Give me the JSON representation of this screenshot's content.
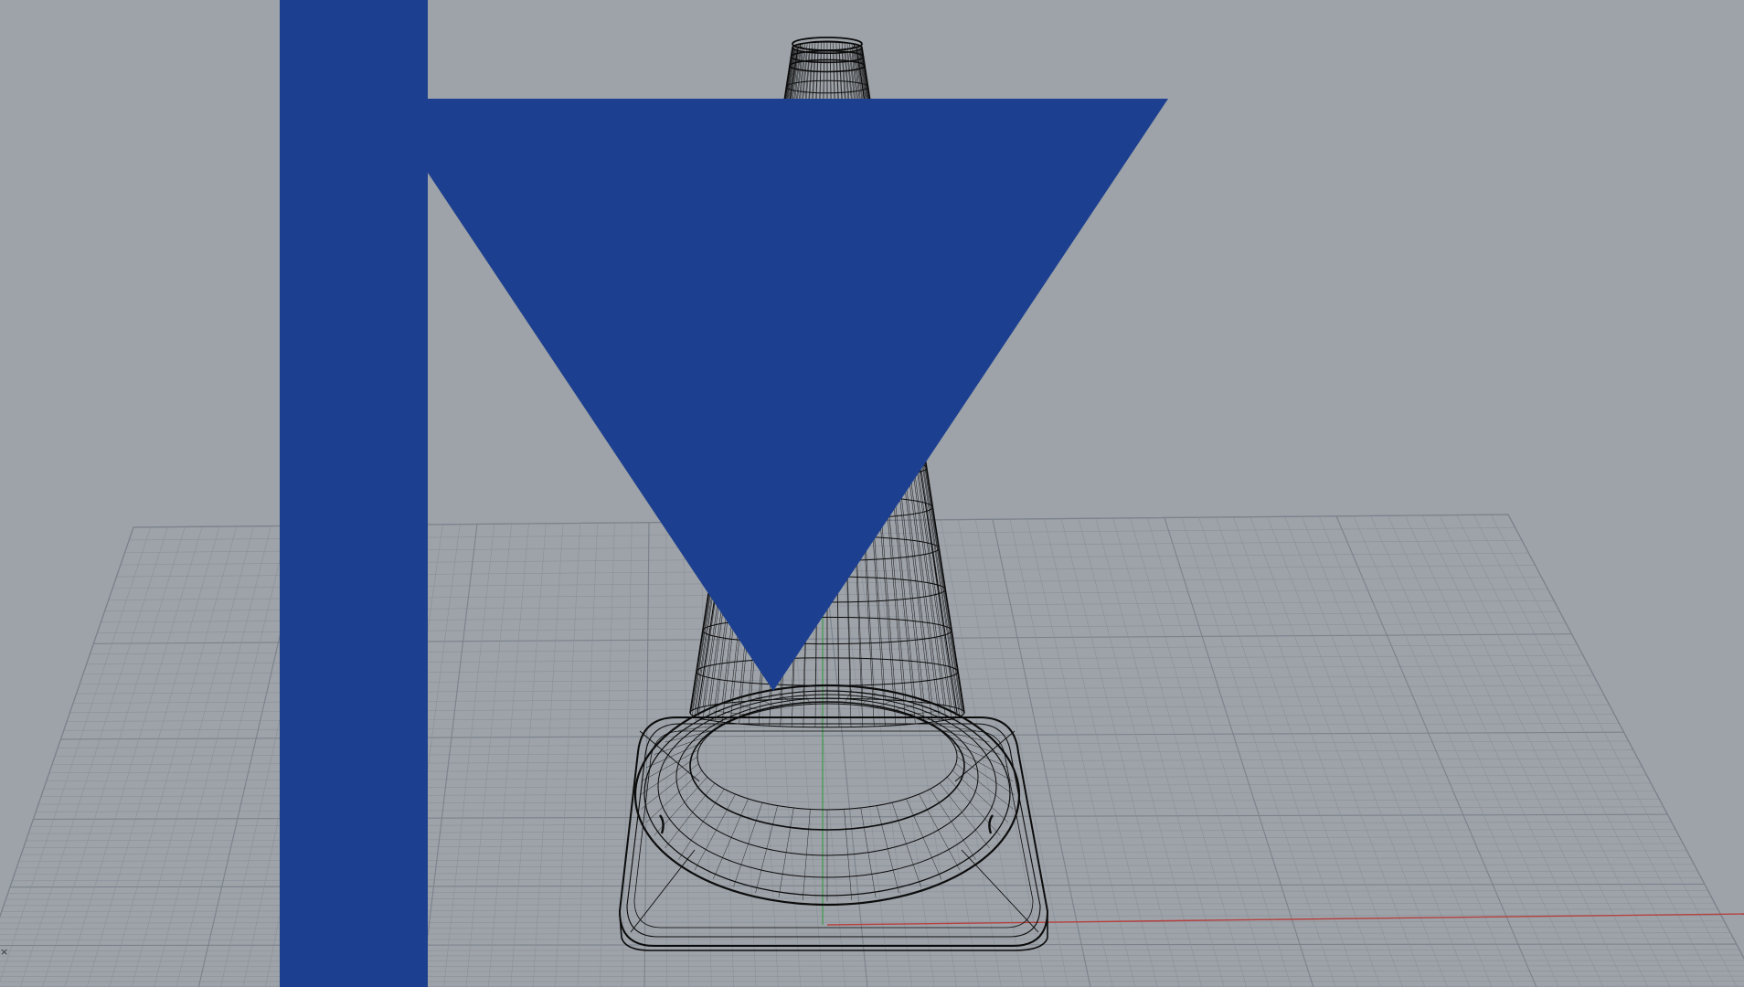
{
  "viewport": {
    "display_mode": "wireframe",
    "background_color": "#9ea3a9",
    "grid_minor_color": "#8a9099",
    "grid_major_color": "#7b828c",
    "x_axis_color": "#b5413f",
    "y_axis_color": "#3f9a47",
    "wire_color": "#0c0c0c",
    "viewport_menu_icon": "viewport-menu-icon",
    "axis_glyph": "×"
  }
}
